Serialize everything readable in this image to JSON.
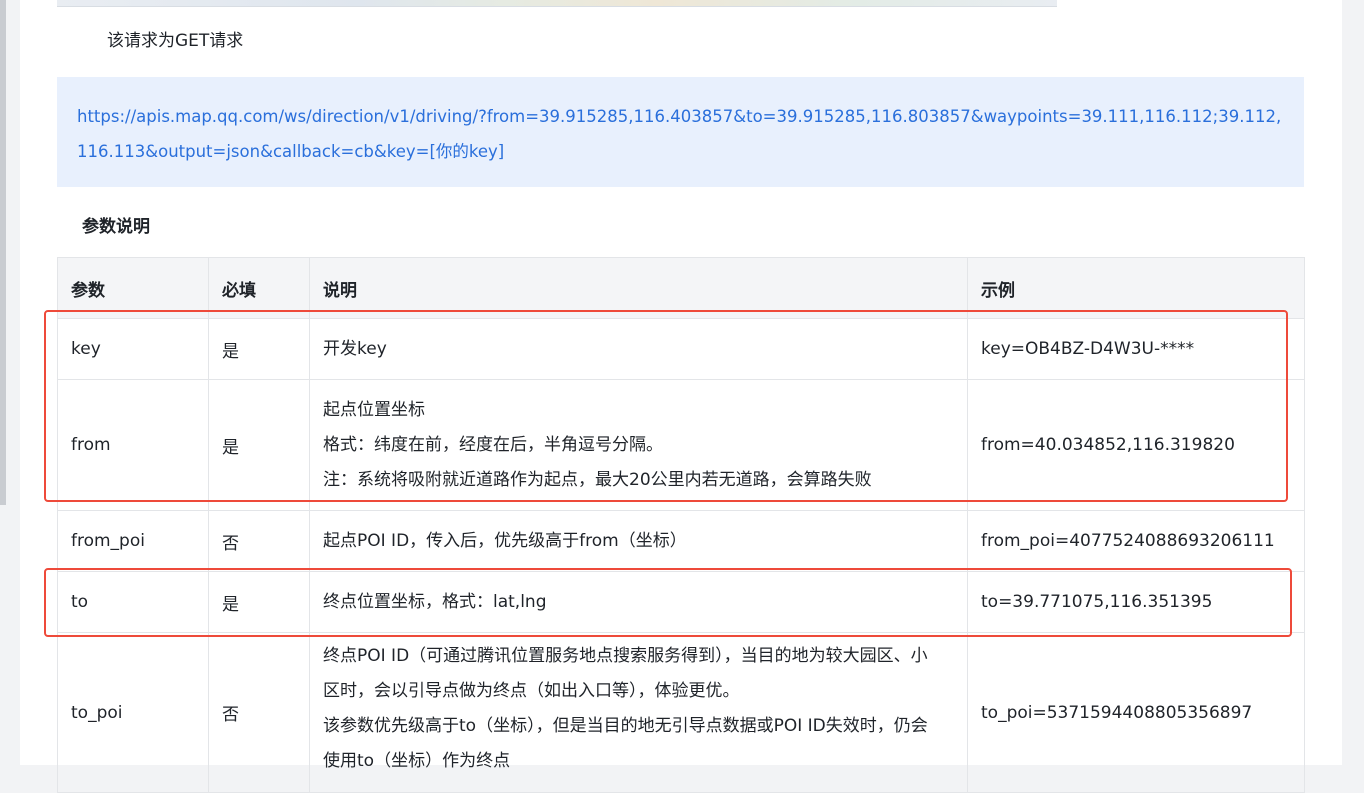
{
  "request_note": "该请求为GET请求",
  "url": {
    "line1": "https://apis.map.qq.com/ws/direction/v1/driving/?from=39.915285,116.403857&to=39.915285,116.803857&waypoints=39.111,116.112;39.112,116.113&outp",
    "line2": "ut=json&callback=cb&key=[你的key]"
  },
  "section_title": "参数说明",
  "table": {
    "headers": [
      "参数",
      "必填",
      "说明",
      "示例"
    ],
    "rows": [
      {
        "param": "key",
        "required": "是",
        "desc": [
          "开发key"
        ],
        "example": "key=OB4BZ-D4W3U-****"
      },
      {
        "param": "from",
        "required": "是",
        "desc": [
          "起点位置坐标",
          "格式：纬度在前，经度在后，半角逗号分隔。",
          "注：系统将吸附就近道路作为起点，最大20公里内若无道路，会算路失败"
        ],
        "example": "from=40.034852,116.319820"
      },
      {
        "param": "from_poi",
        "required": "否",
        "desc": [
          "起点POI ID，传入后，优先级高于from（坐标）"
        ],
        "example": "from_poi=4077524088693206111"
      },
      {
        "param": "to",
        "required": "是",
        "desc": [
          "终点位置坐标，格式：lat,lng"
        ],
        "example": "to=39.771075,116.351395"
      },
      {
        "param": "to_poi",
        "required": "否",
        "desc": [
          "终点POI ID（可通过腾讯位置服务地点搜索服务得到），当目的地为较大园区、小",
          "区时，会以引导点做为终点（如出入口等），体验更优。",
          "该参数优先级高于to（坐标），但是当目的地无引导点数据或POI ID失效时，仍会",
          "使用to（坐标）作为终点"
        ],
        "example": "to_poi=5371594408805356897"
      }
    ]
  },
  "colors": {
    "link": "#2a6fdb",
    "url_bg": "#e8f0fd",
    "highlight": "#ee4a3a"
  }
}
